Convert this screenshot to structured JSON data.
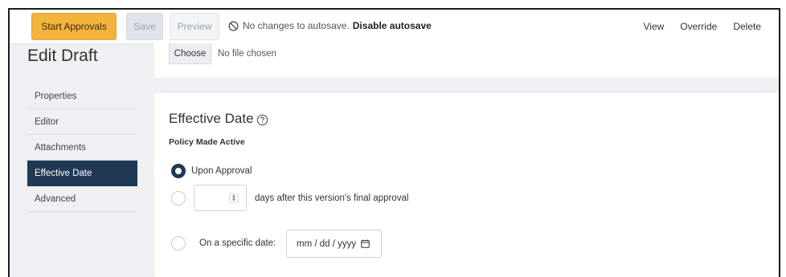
{
  "toolbar": {
    "start_approvals": "Start Approvals",
    "save": "Save",
    "preview": "Preview",
    "autosave_status": "No changes to autosave.",
    "disable_autosave": "Disable autosave",
    "view": "View",
    "override": "Override",
    "delete": "Delete"
  },
  "page": {
    "title": "Edit Draft"
  },
  "sidebar": {
    "items": [
      {
        "label": "Properties",
        "active": false
      },
      {
        "label": "Editor",
        "active": false
      },
      {
        "label": "Attachments",
        "active": false
      },
      {
        "label": "Effective Date",
        "active": true
      },
      {
        "label": "Advanced",
        "active": false
      }
    ]
  },
  "file_upload": {
    "choose_label": "Choose",
    "status": "No file chosen"
  },
  "effective_date": {
    "title": "Effective Date",
    "field_label": "Policy Made Active",
    "options": [
      {
        "label": "Upon Approval",
        "selected": true
      },
      {
        "label": "days after this version's final approval",
        "selected": false,
        "value": ""
      },
      {
        "label": "On a specific date:",
        "selected": false,
        "date_placeholder": "mm / dd / yyyy"
      }
    ]
  },
  "icons": {
    "autosave": "ban-icon",
    "help": "question-circle-icon",
    "date": "calendar-icon",
    "number": "spinner-icon"
  },
  "colors": {
    "primary_button": "#f3b43e",
    "nav_active": "#1f3954",
    "background": "#eef0f3"
  }
}
